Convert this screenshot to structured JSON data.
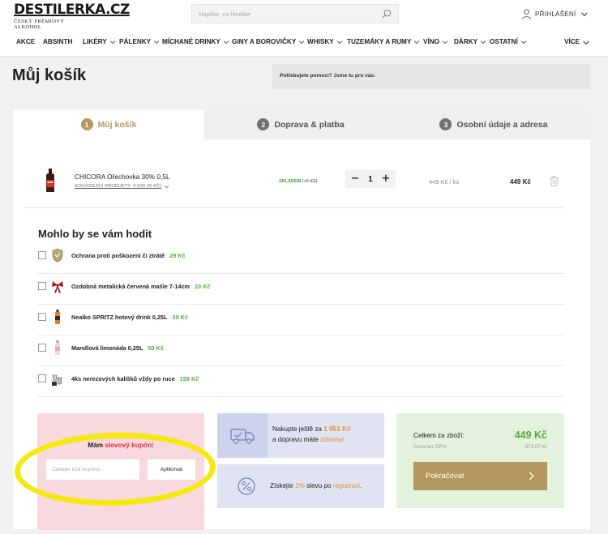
{
  "logo": {
    "name": "DESTILERKA.CZ",
    "tagline": "ČESKÝ PRÉMIOVÝ ALKOHOL"
  },
  "search": {
    "placeholder": "Napište, co hledáte"
  },
  "header": {
    "login_label": "PŘIHLÁŠENÍ"
  },
  "nav": {
    "items": [
      {
        "label": "AKCE"
      },
      {
        "label": "ABSINTH"
      },
      {
        "label": "LIKÉRY"
      },
      {
        "label": "PÁLENKY"
      },
      {
        "label": "MÍCHANÉ DRINKY"
      },
      {
        "label": "GINY A BOROVIČKY"
      },
      {
        "label": "WHISKY"
      },
      {
        "label": "TUZEMÁKY A RUMY"
      },
      {
        "label": "VÍNO"
      },
      {
        "label": "DÁRKY"
      },
      {
        "label": "OSTATNÍ"
      },
      {
        "label": "VÍCE"
      }
    ]
  },
  "page": {
    "title": "Můj košík",
    "help_text": "Potřebujete pomoci? Jsme tu pro vás:"
  },
  "steps": [
    {
      "num": "1",
      "label": "Můj košík"
    },
    {
      "num": "2",
      "label": "Doprava & platba"
    },
    {
      "num": "3",
      "label": "Osobní údaje a adresa"
    }
  ],
  "cart": {
    "items": [
      {
        "name": "CHICORA Ořechovka 30% 0,5L",
        "related": "SOUVISEJÍCÍ PRODUKTY: 4 (OD 35 KČ)",
        "stock_status": "SKLADEM",
        "stock_count": "(>5 KS)",
        "quantity": "1",
        "unit_price": "449 Kč  / ks",
        "total": "449 Kč"
      }
    ]
  },
  "suggestions": {
    "title": "Mohlo by se vám hodit",
    "items": [
      {
        "name": "Ochrana proti poškození či ztrátě",
        "price": "29 Kč"
      },
      {
        "name": "Ozdobná metalická červená mašle 7-14cm",
        "price": "20 Kč"
      },
      {
        "name": "Nealko SPRITZ hotový drink 0,25L",
        "price": "39 Kč"
      },
      {
        "name": "Mandlová limonáda 0,25L",
        "price": "50 Kč"
      },
      {
        "name": "4ks nerezových kalíšků vždy po ruce",
        "price": "159 Kč"
      }
    ]
  },
  "coupon": {
    "title_pre": "Mám ",
    "title_highlight": "slevový kupón",
    "title_post": ":",
    "placeholder": "Zadejte kód kupónu",
    "apply_label": "Aplikovat"
  },
  "shipping": {
    "text_1": "Nakupte ještě za ",
    "amount": "1 051 Kč",
    "text_2": "a dopravu máte ",
    "free": "zdarma!"
  },
  "discount": {
    "text_1": "Získejte ",
    "percent": "1%",
    "text_2": " slevu po ",
    "link": "registraci",
    "text_3": "."
  },
  "summary": {
    "label": "Celkem za zboží:",
    "total": "449 Kč",
    "label_novat": "Cena bez DPH",
    "total_novat": "371,07 Kč",
    "continue_label": "Pokračovat"
  },
  "colors": {
    "accent_gold": "#b59760",
    "green": "#5aa83c",
    "coupon_bg": "#f8d9dd",
    "info_bg": "#dfe3f2",
    "summary_bg": "#e3f2dc",
    "highlight_yellow": "#f5e90d"
  }
}
